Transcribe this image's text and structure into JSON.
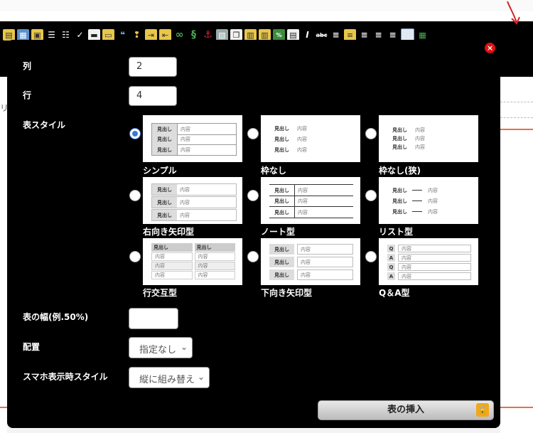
{
  "labels": {
    "cols": "列",
    "rows": "行",
    "style": "表スタイル",
    "width": "表の幅(例.50%)",
    "align": "配置",
    "mobile": "スマホ表示時スタイル"
  },
  "inputs": {
    "cols_value": "2",
    "rows_value": "4",
    "width_value": ""
  },
  "selects": {
    "align_value": "指定なし",
    "mobile_value": "縦に組み替え"
  },
  "thumb_text": {
    "head": "見出し",
    "body": "内容",
    "q": "Q",
    "a": "A"
  },
  "styles": [
    {
      "caption": "シンプル",
      "selected": true
    },
    {
      "caption": "枠なし",
      "selected": false
    },
    {
      "caption": "枠なし(狭)",
      "selected": false
    },
    {
      "caption": "右向き矢印型",
      "selected": false
    },
    {
      "caption": "ノート型",
      "selected": false
    },
    {
      "caption": "リスト型",
      "selected": false
    },
    {
      "caption": "行交互型",
      "selected": false
    },
    {
      "caption": "下向き矢印型",
      "selected": false
    },
    {
      "caption": "Q＆A型",
      "selected": false
    }
  ],
  "insert_label": "表の挿入",
  "left_char": "リ",
  "toolbar_icons": [
    "paste-icon",
    "image-icon",
    "photo-icon",
    "bullet-list-icon",
    "numbered-list-icon",
    "check-list-icon",
    "hr-icon",
    "box-icon",
    "quote-icon",
    "footprint-icon",
    "indent-icon",
    "outdent-icon",
    "link-icon",
    "unlink-icon",
    "anchor-icon",
    "gallery-icon",
    "copy-icon",
    "clipboard-icon",
    "clipboard-icon",
    "percent-icon",
    "card-icon",
    "italic-icon",
    "strike-icon",
    "align-justify-icon",
    "align-middle-icon",
    "align-left-icon",
    "align-center-icon",
    "align-right-icon",
    "table-icon",
    "table2-icon"
  ],
  "colors": {
    "accent": "#3a78d8",
    "arrow": "#d22222",
    "close": "#dd1111",
    "lock": "#f2a71b"
  }
}
